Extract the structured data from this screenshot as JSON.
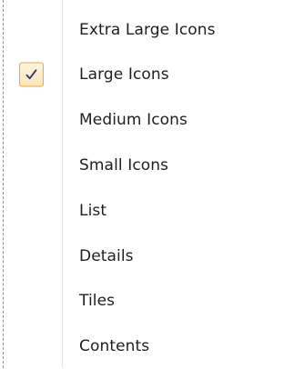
{
  "menu": {
    "items": [
      {
        "label": "Extra Large Icons",
        "checked": false
      },
      {
        "label": "Large Icons",
        "checked": true
      },
      {
        "label": "Medium Icons",
        "checked": false
      },
      {
        "label": "Small Icons",
        "checked": false
      },
      {
        "label": "List",
        "checked": false
      },
      {
        "label": "Details",
        "checked": false
      },
      {
        "label": "Tiles",
        "checked": false
      },
      {
        "label": "Contents",
        "checked": false
      }
    ]
  },
  "colors": {
    "check_border": "#e9a64a",
    "check_fill": "#fde6b8",
    "checkmark": "#1f3a6e",
    "text": "#1e1e1e"
  },
  "icons": {
    "checked_item": "checkmark-icon"
  }
}
